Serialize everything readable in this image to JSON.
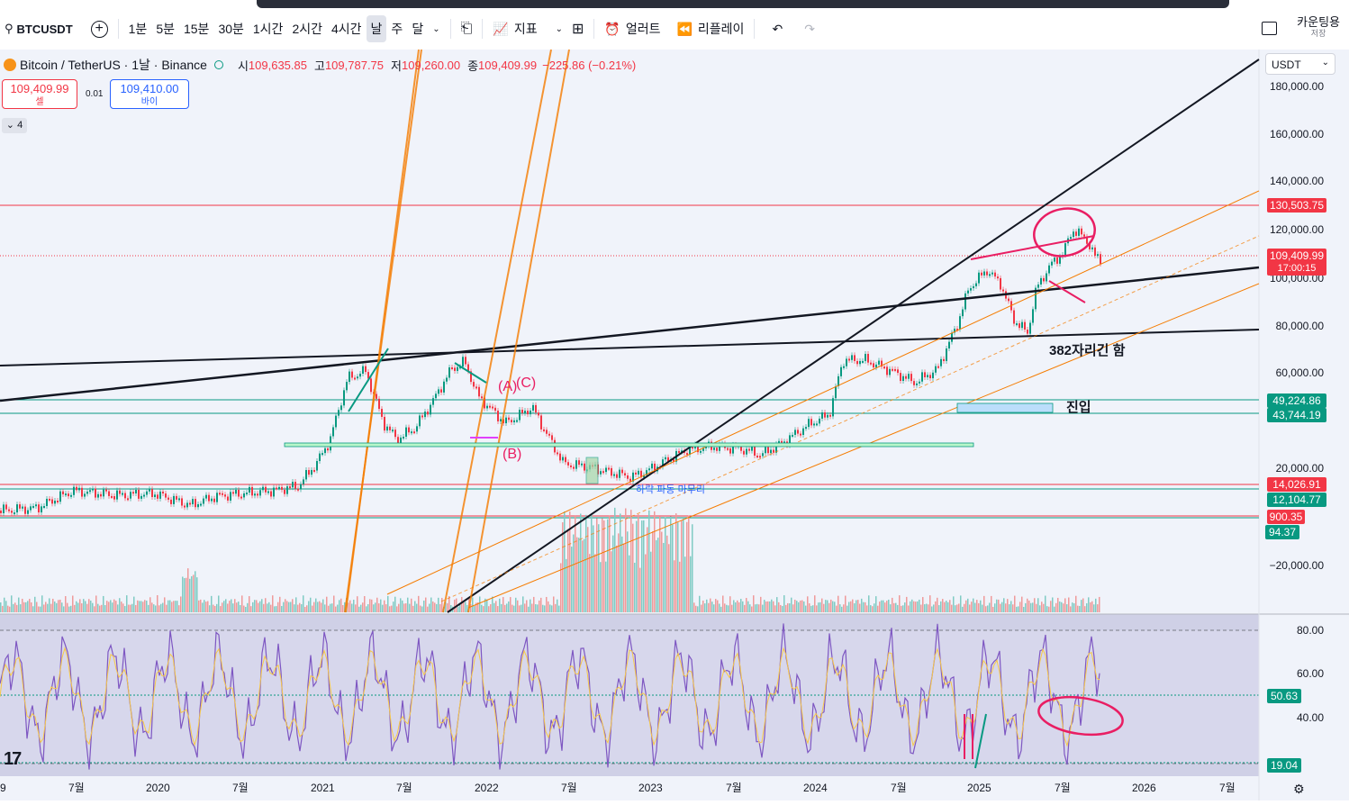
{
  "toolbar": {
    "symbol": "BTCUSDT",
    "timeframes": [
      "1분",
      "5분",
      "15분",
      "30분",
      "1시간",
      "2시간",
      "4시간",
      "날",
      "주",
      "달"
    ],
    "active_timeframe": "날",
    "indicators_label": "지표",
    "alert_label": "얼러트",
    "replay_label": "리플레이",
    "countdown_label": "카운팅용",
    "save_label": "저장"
  },
  "legend": {
    "title": "Bitcoin / TetherUS · 1날 · Binance",
    "open_label": "시",
    "open": "109,635.85",
    "high_label": "고",
    "high": "109,787.75",
    "low_label": "저",
    "low": "109,260.00",
    "close_label": "종",
    "close": "109,409.99",
    "change": "−225.86 (−0.21%)"
  },
  "trade": {
    "sell_price": "109,409.99",
    "sell_label": "셀",
    "buy_price": "109,410.00",
    "buy_label": "바이",
    "spread": "0.01"
  },
  "collapse_label": "4",
  "currency": "USDT",
  "colors": {
    "up": "#089981",
    "down": "#f23645",
    "rsi": "#7e57c2",
    "rsi_ma": "#f7c948",
    "fib": "#f57c00",
    "marker": "#e91e63"
  },
  "chart_data": {
    "type": "line",
    "title": "",
    "symbol": "BTCUSDT",
    "x_ticks": [
      "9",
      "7월",
      "2020",
      "7월",
      "2021",
      "7월",
      "2022",
      "7월",
      "2023",
      "7월",
      "2024",
      "7월",
      "2025",
      "7월",
      "2026",
      "7월"
    ],
    "y_ticks": [
      "180,000.00",
      "160,000.00",
      "140,000.00",
      "120,000.00",
      "100,000.00",
      "80,000.00",
      "60,000.00",
      "20,000.00",
      "−20,000.00"
    ],
    "series": [
      {
        "x": [
          "2019-05",
          "2019-07",
          "2019-10",
          "2020-01",
          "2020-03",
          "2020-07",
          "2020-10",
          "2021-01",
          "2021-04",
          "2021-07",
          "2021-11",
          "2022-01",
          "2022-04",
          "2022-06",
          "2022-11",
          "2023-03",
          "2023-07",
          "2023-10",
          "2024-03",
          "2024-08",
          "2024-12",
          "2025-04",
          "2025-08",
          "2025-09"
        ],
        "values": [
          8000,
          11000,
          9000,
          8000,
          5000,
          9500,
          11500,
          33000,
          63000,
          32000,
          68000,
          45000,
          42000,
          20000,
          16000,
          28000,
          30000,
          34000,
          71000,
          57000,
          100000,
          75000,
          123000,
          109410
        ]
      }
    ],
    "price_tags": [
      {
        "value": "130,503.75",
        "color": "#f23645"
      },
      {
        "value": "109,409.99",
        "sub": "17:00:15",
        "color": "#f23645"
      },
      {
        "value": "49,224.86",
        "color": "#089981"
      },
      {
        "value": "43,744.19",
        "color": "#089981"
      },
      {
        "value": "14,026.91",
        "color": "#f23645"
      },
      {
        "value": "12,104.77",
        "color": "#089981"
      },
      {
        "value": "900.35",
        "color": "#f23645"
      },
      {
        "value": "94.37",
        "color": "#089981"
      }
    ],
    "annotations": [
      "382자리긴 함",
      "진입",
      "(A)",
      "(C)",
      "(B)",
      "하락 파동 마무리"
    ],
    "rsi": {
      "y_ticks": [
        "80.00",
        "60.00",
        "40.00"
      ],
      "tags": [
        {
          "value": "50.63",
          "color": "#089981"
        },
        {
          "value": "19.04",
          "color": "#089981"
        }
      ],
      "upper_band": 80,
      "lower_band": 20
    }
  }
}
